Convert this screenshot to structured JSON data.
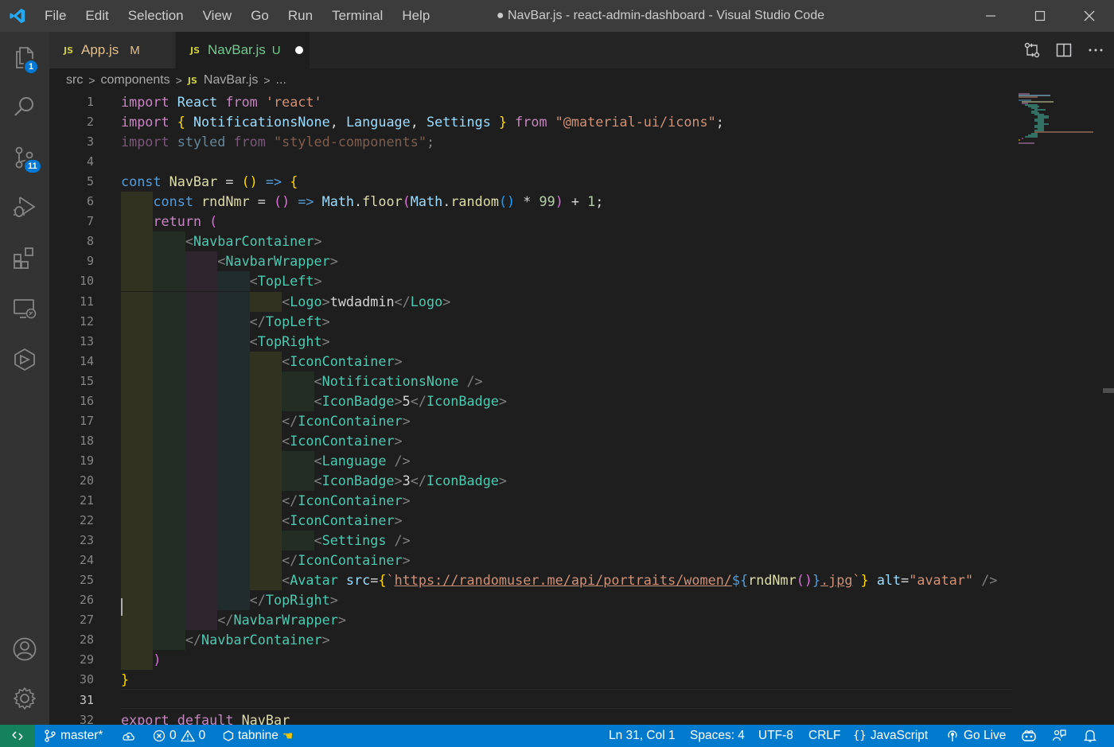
{
  "window": {
    "title": "● NavBar.js - react-admin-dashboard - Visual Studio Code",
    "menu": [
      "File",
      "Edit",
      "Selection",
      "View",
      "Go",
      "Run",
      "Terminal",
      "Help"
    ]
  },
  "activity_bar": {
    "explorer_badge": "1",
    "scm_badge": "11",
    "icons": [
      "explorer-icon",
      "search-icon",
      "source-control-icon",
      "run-debug-icon",
      "extensions-icon",
      "remote-explorer-icon",
      "tabnine-hub-icon",
      "accounts-icon",
      "manage-gear-icon"
    ]
  },
  "tabs": [
    {
      "icon": "JS",
      "label": "App.js",
      "status": "M",
      "status_color": "#e2c08d",
      "label_color": "#e2c08d"
    },
    {
      "icon": "JS",
      "label": "NavBar.js",
      "status": "U",
      "status_color": "#73c991",
      "label_color": "#73c991",
      "dirty": true
    }
  ],
  "breadcrumb": {
    "parts": [
      "src",
      "components",
      "NavBar.js",
      "..."
    ],
    "file_icon": "JS"
  },
  "editor": {
    "active_line": 31,
    "lines": [
      [
        [
          "kc",
          "import "
        ],
        [
          "var",
          "React "
        ],
        [
          "kc",
          "from "
        ],
        [
          "str",
          "'react'"
        ]
      ],
      [
        [
          "kc",
          "import "
        ],
        [
          "br1",
          "{ "
        ],
        [
          "var",
          "NotificationsNone"
        ],
        [
          "t",
          ", "
        ],
        [
          "var",
          "Language"
        ],
        [
          "t",
          ", "
        ],
        [
          "var",
          "Settings "
        ],
        [
          "br1",
          "} "
        ],
        [
          "kc",
          "from "
        ],
        [
          "str",
          "\"@material-ui/icons\""
        ],
        [
          "t",
          ";"
        ]
      ],
      [
        [
          "kc dim",
          "import "
        ],
        [
          "var dim",
          "styled "
        ],
        [
          "kc dim",
          "from "
        ],
        [
          "str dim",
          "\"styled-components\""
        ],
        [
          "t dim",
          ";"
        ]
      ],
      [],
      [
        [
          "kw",
          "const "
        ],
        [
          "fn",
          "NavBar "
        ],
        [
          "t",
          "= "
        ],
        [
          "br1",
          "() "
        ],
        [
          "kw",
          "=> "
        ],
        [
          "br1",
          "{"
        ]
      ],
      [
        [
          "t",
          "    "
        ],
        [
          "kw",
          "const "
        ],
        [
          "fn",
          "rndNmr "
        ],
        [
          "t",
          "= "
        ],
        [
          "br2",
          "() "
        ],
        [
          "kw",
          "=> "
        ],
        [
          "var",
          "Math"
        ],
        [
          "t",
          "."
        ],
        [
          "fn",
          "floor"
        ],
        [
          "br2",
          "("
        ],
        [
          "var",
          "Math"
        ],
        [
          "t",
          "."
        ],
        [
          "fn",
          "random"
        ],
        [
          "br3",
          "() "
        ],
        [
          "t",
          "* "
        ],
        [
          "num",
          "99"
        ],
        [
          "br2",
          ") "
        ],
        [
          "t",
          "+ "
        ],
        [
          "num",
          "1"
        ],
        [
          "t",
          ";"
        ]
      ],
      [
        [
          "t",
          "    "
        ],
        [
          "kc",
          "return "
        ],
        [
          "br2",
          "("
        ]
      ],
      [
        [
          "t",
          "        "
        ],
        [
          "pun",
          "<"
        ],
        [
          "tag",
          "NavbarContainer"
        ],
        [
          "pun",
          ">"
        ]
      ],
      [
        [
          "t",
          "            "
        ],
        [
          "pun",
          "<"
        ],
        [
          "tag",
          "NavbarWrapper"
        ],
        [
          "pun",
          ">"
        ]
      ],
      [
        [
          "t",
          "                "
        ],
        [
          "pun",
          "<"
        ],
        [
          "tag",
          "TopLeft"
        ],
        [
          "pun",
          ">"
        ]
      ],
      [
        [
          "t",
          "                    "
        ],
        [
          "pun",
          "<"
        ],
        [
          "tag",
          "Logo"
        ],
        [
          "pun",
          ">"
        ],
        [
          "t",
          "twdadmin"
        ],
        [
          "pun",
          "</"
        ],
        [
          "tag",
          "Logo"
        ],
        [
          "pun",
          ">"
        ]
      ],
      [
        [
          "t",
          "                "
        ],
        [
          "pun",
          "</"
        ],
        [
          "tag",
          "TopLeft"
        ],
        [
          "pun",
          ">"
        ]
      ],
      [
        [
          "t",
          "                "
        ],
        [
          "pun",
          "<"
        ],
        [
          "tag",
          "TopRight"
        ],
        [
          "pun",
          ">"
        ]
      ],
      [
        [
          "t",
          "                    "
        ],
        [
          "pun",
          "<"
        ],
        [
          "tag",
          "IconContainer"
        ],
        [
          "pun",
          ">"
        ]
      ],
      [
        [
          "t",
          "                        "
        ],
        [
          "pun",
          "<"
        ],
        [
          "tag",
          "NotificationsNone "
        ],
        [
          "pun",
          "/>"
        ]
      ],
      [
        [
          "t",
          "                        "
        ],
        [
          "pun",
          "<"
        ],
        [
          "tag",
          "IconBadge"
        ],
        [
          "pun",
          ">"
        ],
        [
          "t",
          "5"
        ],
        [
          "pun",
          "</"
        ],
        [
          "tag",
          "IconBadge"
        ],
        [
          "pun",
          ">"
        ]
      ],
      [
        [
          "t",
          "                    "
        ],
        [
          "pun",
          "</"
        ],
        [
          "tag",
          "IconContainer"
        ],
        [
          "pun",
          ">"
        ]
      ],
      [
        [
          "t",
          "                    "
        ],
        [
          "pun",
          "<"
        ],
        [
          "tag",
          "IconContainer"
        ],
        [
          "pun",
          ">"
        ]
      ],
      [
        [
          "t",
          "                        "
        ],
        [
          "pun",
          "<"
        ],
        [
          "tag",
          "Language "
        ],
        [
          "pun",
          "/>"
        ]
      ],
      [
        [
          "t",
          "                        "
        ],
        [
          "pun",
          "<"
        ],
        [
          "tag",
          "IconBadge"
        ],
        [
          "pun",
          ">"
        ],
        [
          "t",
          "3"
        ],
        [
          "pun",
          "</"
        ],
        [
          "tag",
          "IconBadge"
        ],
        [
          "pun",
          ">"
        ]
      ],
      [
        [
          "t",
          "                    "
        ],
        [
          "pun",
          "</"
        ],
        [
          "tag",
          "IconContainer"
        ],
        [
          "pun",
          ">"
        ]
      ],
      [
        [
          "t",
          "                    "
        ],
        [
          "pun",
          "<"
        ],
        [
          "tag",
          "IconContainer"
        ],
        [
          "pun",
          ">"
        ]
      ],
      [
        [
          "t",
          "                        "
        ],
        [
          "pun",
          "<"
        ],
        [
          "tag",
          "Settings "
        ],
        [
          "pun",
          "/>"
        ]
      ],
      [
        [
          "t",
          "                    "
        ],
        [
          "pun",
          "</"
        ],
        [
          "tag",
          "IconContainer"
        ],
        [
          "pun",
          ">"
        ]
      ],
      [
        [
          "t",
          "                    "
        ],
        [
          "pun",
          "<"
        ],
        [
          "tag",
          "Avatar "
        ],
        [
          "var",
          "src"
        ],
        [
          "t",
          "="
        ],
        [
          "br1",
          "{"
        ],
        [
          "str",
          "`"
        ],
        [
          "url",
          "https://randomuser.me/api/portraits/women/"
        ],
        [
          "kw",
          "${"
        ],
        [
          "fn",
          "rndNmr"
        ],
        [
          "br2",
          "()"
        ],
        [
          "kw",
          "}"
        ],
        [
          "url",
          ".jpg"
        ],
        [
          "str",
          "`"
        ],
        [
          "br1",
          "} "
        ],
        [
          "var",
          "alt"
        ],
        [
          "t",
          "="
        ],
        [
          "str",
          "\"avatar\" "
        ],
        [
          "pun",
          "/>"
        ]
      ],
      [
        [
          "t",
          "                "
        ],
        [
          "pun",
          "</"
        ],
        [
          "tag",
          "TopRight"
        ],
        [
          "pun",
          ">"
        ]
      ],
      [
        [
          "t",
          "            "
        ],
        [
          "pun",
          "</"
        ],
        [
          "tag",
          "NavbarWrapper"
        ],
        [
          "pun",
          ">"
        ]
      ],
      [
        [
          "t",
          "        "
        ],
        [
          "pun",
          "</"
        ],
        [
          "tag",
          "NavbarContainer"
        ],
        [
          "pun",
          ">"
        ]
      ],
      [
        [
          "t",
          "    "
        ],
        [
          "br2",
          ")"
        ]
      ],
      [
        [
          "br1",
          "}"
        ]
      ],
      [],
      [
        [
          "kc",
          "export "
        ],
        [
          "kc",
          "default "
        ],
        [
          "fn",
          "NavBar"
        ]
      ]
    ]
  },
  "statusbar": {
    "branch": "master*",
    "errors": "0",
    "warnings": "0",
    "tabnine": "tabnine",
    "position": "Ln 31, Col 1",
    "spaces": "Spaces: 4",
    "encoding": "UTF-8",
    "eol": "CRLF",
    "language": "JavaScript",
    "golive": "Go Live"
  },
  "colors": {
    "statusbar": "#007acc",
    "remote": "#16825d",
    "titlebar": "#3c3c3c",
    "activitybar": "#333333",
    "editor": "#1e1e1e"
  }
}
